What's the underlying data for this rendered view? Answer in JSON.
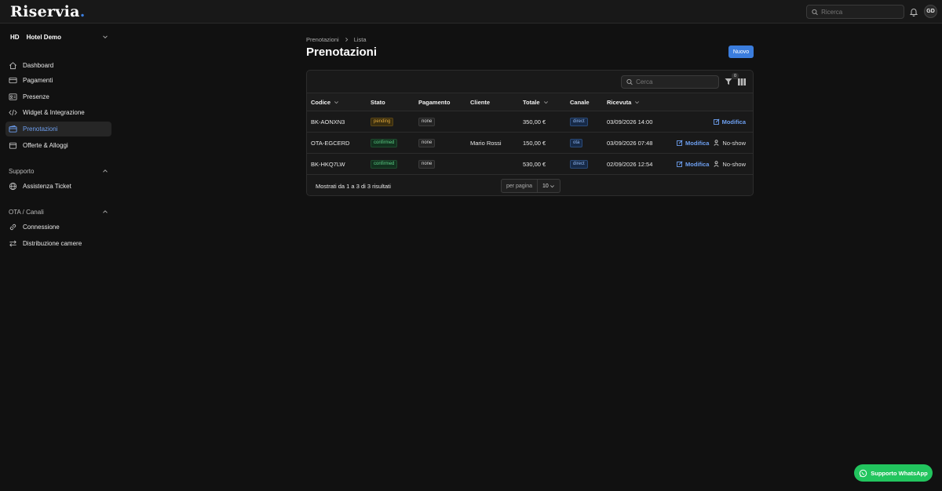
{
  "app": {
    "logo": "Riservia",
    "logo_dot": ".",
    "search_placeholder": "Ricerca",
    "avatar_initials": "GD"
  },
  "sidebar": {
    "hotel_abbr": "HD",
    "hotel_name": "Hotel Demo",
    "main_items": [
      {
        "label": "Dashboard",
        "icon": "home-icon"
      },
      {
        "label": "Pagamenti",
        "icon": "credit-card-icon"
      },
      {
        "label": "Presenze",
        "icon": "id-card-icon"
      },
      {
        "label": "Widget & Integrazione",
        "icon": "code-icon"
      },
      {
        "label": "Prenotazioni",
        "icon": "wallet-icon",
        "active": true
      },
      {
        "label": "Offerte & Alloggi",
        "icon": "gift-icon"
      }
    ],
    "support_section": {
      "title": "Supporto",
      "items": [
        {
          "label": "Assistenza Ticket",
          "icon": "globe-icon"
        }
      ]
    },
    "ota_section": {
      "title": "OTA / Canali",
      "items": [
        {
          "label": "Connessione",
          "icon": "link-icon"
        },
        {
          "label": "Distribuzione camere",
          "icon": "swap-icon"
        }
      ]
    }
  },
  "main": {
    "breadcrumb": [
      "Prenotazioni",
      "Lista"
    ],
    "title": "Prenotazioni",
    "new_button": "Nuovo",
    "table_search_placeholder": "Cerca",
    "filter_count": "0",
    "columns": [
      "Codice",
      "Stato",
      "Pagamento",
      "Cliente",
      "Totale",
      "Canale",
      "Ricevuta"
    ],
    "rows": [
      {
        "codice": "BK-AONXN3",
        "stato": "pending",
        "pagamento": "none",
        "cliente": "",
        "totale": "350,00 €",
        "canale": "direct",
        "ricevuta": "03/09/2026 14:00",
        "edit": "Modifica",
        "noshow": ""
      },
      {
        "codice": "OTA-EGCERD",
        "stato": "confirmed",
        "pagamento": "none",
        "cliente": "Mario Rossi",
        "totale": "150,00 €",
        "canale": "ota",
        "ricevuta": "03/09/2026 07:48",
        "edit": "Modifica",
        "noshow": "No-show"
      },
      {
        "codice": "BK-HKQ7LW",
        "stato": "confirmed",
        "pagamento": "none",
        "cliente": "",
        "totale": "530,00 €",
        "canale": "direct",
        "ricevuta": "02/09/2026 12:54",
        "edit": "Modifica",
        "noshow": "No-show"
      }
    ],
    "results_text": "Mostrati da 1 a 3 di 3 risultati",
    "per_page_label": "per pagina",
    "per_page_value": "10"
  },
  "whatsapp_button": "Supporto WhatsApp",
  "colors": {
    "accent": "#3b7ddd",
    "whatsapp": "#22c55e",
    "background": "#111111"
  }
}
